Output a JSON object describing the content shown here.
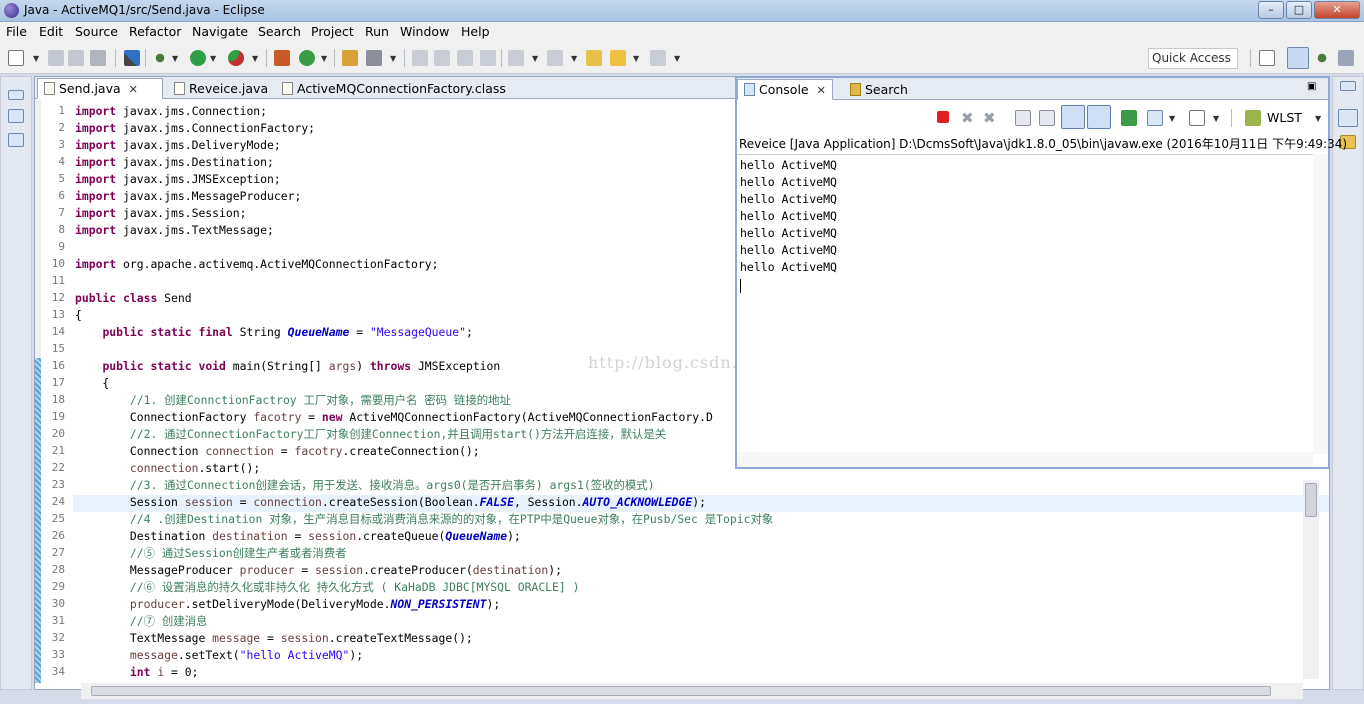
{
  "window": {
    "title": "Java - ActiveMQ1/src/Send.java - Eclipse"
  },
  "menu": [
    "File",
    "Edit",
    "Source",
    "Refactor",
    "Navigate",
    "Search",
    "Project",
    "Run",
    "Window",
    "Help"
  ],
  "toolbar": {
    "quick_access_placeholder": "Quick Access"
  },
  "editor": {
    "tabs": [
      {
        "label": "Send.java",
        "active": true,
        "closable": true
      },
      {
        "label": "Reveice.java",
        "active": false
      },
      {
        "label": "ActiveMQConnectionFactory.class",
        "active": false
      }
    ],
    "line_numbers": [
      "1",
      "2",
      "3",
      "4",
      "5",
      "6",
      "7",
      "8",
      "9",
      "10",
      "11",
      "12",
      "13",
      "14",
      "15",
      "16",
      "17",
      "18",
      "19",
      "20",
      "21",
      "22",
      "23",
      "24",
      "25",
      "26",
      "27",
      "28",
      "29",
      "30",
      "31",
      "32",
      "33",
      "34"
    ],
    "code_lines": [
      "import javax.jms.Connection;",
      "import javax.jms.ConnectionFactory;",
      "import javax.jms.DeliveryMode;",
      "import javax.jms.Destination;",
      "import javax.jms.JMSException;",
      "import javax.jms.MessageProducer;",
      "import javax.jms.Session;",
      "import javax.jms.TextMessage;",
      "",
      "import org.apache.activemq.ActiveMQConnectionFactory;",
      "",
      "public class Send",
      "{",
      "    public static final String QueueName = \"MessageQueue\";",
      "",
      "    public static void main(String[] args) throws JMSException",
      "    {",
      "        //1. 创建ConnctionFactroy 工厂对象，需要用户名 密码 链接的地址",
      "        ConnectionFactory facotry = new ActiveMQConnectionFactory(ActiveMQConnectionFactory.D",
      "        //2. 通过ConnectionFactory工厂对象创建Connection,并且调用start()方法开启连接，默认是关",
      "        Connection connection = facotry.createConnection();",
      "        connection.start();",
      "        //3. 通过Connection创建会话，用于发送、接收消息。args0(是否开启事务) args1(签收的模式)",
      "        Session session = connection.createSession(Boolean.FALSE, Session.AUTO_ACKNOWLEDGE);",
      "        //4 .创建Destination 对象，生产消息目标或消费消息来源的的对象，在PTP中是Queue对象，在Pusb/Sec 是Topic对象",
      "        Destination destination = session.createQueue(QueueName);",
      "        //⑤ 通过Session创建生产者或者消费者",
      "        MessageProducer producer = session.createProducer(destination);",
      "        //⑥ 设置消息的持久化或非持久化 持久化方式 ( KaHaDB JDBC[MYSQL ORACLE] )",
      "        producer.setDeliveryMode(DeliveryMode.NON_PERSISTENT);",
      "        //⑦ 创建消息",
      "        TextMessage message = session.createTextMessage();",
      "        message.setText(\"hello ActiveMQ\");",
      "        int i = 0;"
    ]
  },
  "console": {
    "tabs": [
      {
        "label": "Console",
        "active": true
      },
      {
        "label": "Search",
        "active": false
      }
    ],
    "wlst_label": "WLST",
    "description": "Reveice [Java Application] D:\\DcmsSoft\\Java\\jdk1.8.0_05\\bin\\javaw.exe (2016年10月11日 下午9:49:34)",
    "output": [
      "hello ActiveMQ",
      "hello ActiveMQ",
      "hello ActiveMQ",
      "hello ActiveMQ",
      "hello ActiveMQ",
      "hello ActiveMQ",
      "hello ActiveMQ"
    ]
  },
  "watermark": "http://blog.csdn.net/",
  "colors": {
    "keyword": "#7f0055",
    "string": "#2a00ff",
    "comment": "#3f7f5f",
    "field": "#0000c0",
    "stop": "#e02020"
  }
}
